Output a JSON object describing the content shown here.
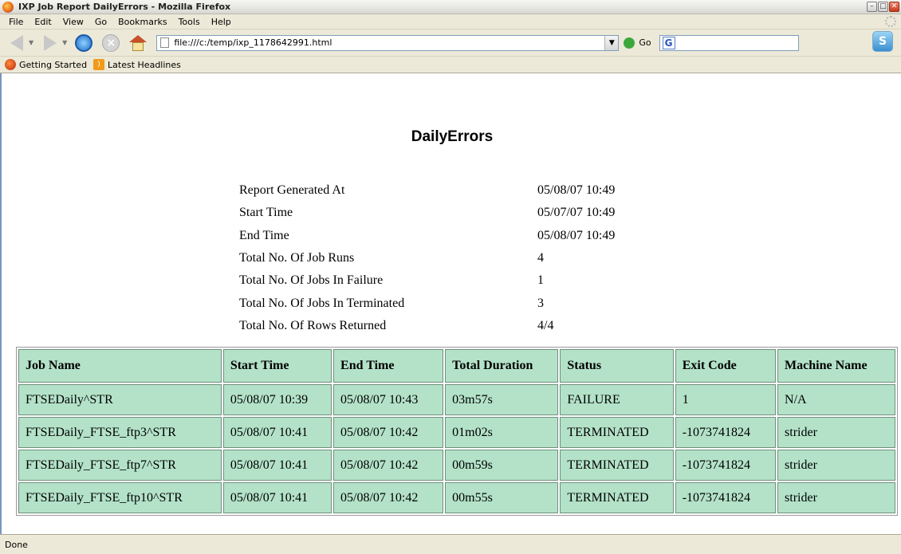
{
  "window": {
    "title": "IXP Job Report DailyErrors - Mozilla Firefox",
    "controls": [
      "–",
      "□",
      "✕"
    ]
  },
  "menu": [
    "File",
    "Edit",
    "View",
    "Go",
    "Bookmarks",
    "Tools",
    "Help"
  ],
  "navbar": {
    "url": "file:///c:/temp/ixp_1178642991.html",
    "go_label": "Go",
    "search_icon_letter": "G"
  },
  "bookmarks": [
    "Getting Started",
    "Latest Headlines"
  ],
  "report": {
    "title": "DailyErrors",
    "summary": [
      {
        "label": "Report Generated At",
        "value": "05/08/07 10:49"
      },
      {
        "label": "Start Time",
        "value": "05/07/07 10:49"
      },
      {
        "label": "End Time",
        "value": "05/08/07 10:49"
      },
      {
        "label": "Total No. Of Job Runs",
        "value": "4"
      },
      {
        "label": "Total No. Of Jobs In Failure",
        "value": "1"
      },
      {
        "label": "Total No. Of Jobs In Terminated",
        "value": "3"
      },
      {
        "label": "Total No. Of Rows Returned",
        "value": "4/4"
      }
    ],
    "columns": [
      "Job Name",
      "Start Time",
      "End Time",
      "Total Duration",
      "Status",
      "Exit Code",
      "Machine Name"
    ],
    "rows": [
      [
        "FTSEDaily^STR",
        "05/08/07 10:39",
        "05/08/07 10:43",
        "03m57s",
        "FAILURE",
        "1",
        "N/A"
      ],
      [
        "FTSEDaily_FTSE_ftp3^STR",
        "05/08/07 10:41",
        "05/08/07 10:42",
        "01m02s",
        "TERMINATED",
        "-1073741824",
        "strider"
      ],
      [
        "FTSEDaily_FTSE_ftp7^STR",
        "05/08/07 10:41",
        "05/08/07 10:42",
        "00m59s",
        "TERMINATED",
        "-1073741824",
        "strider"
      ],
      [
        "FTSEDaily_FTSE_ftp10^STR",
        "05/08/07 10:41",
        "05/08/07 10:42",
        "00m55s",
        "TERMINATED",
        "-1073741824",
        "strider"
      ]
    ]
  },
  "status": "Done",
  "colors": {
    "table_cell": "#b3e2c8",
    "chrome": "#ece9d8"
  }
}
